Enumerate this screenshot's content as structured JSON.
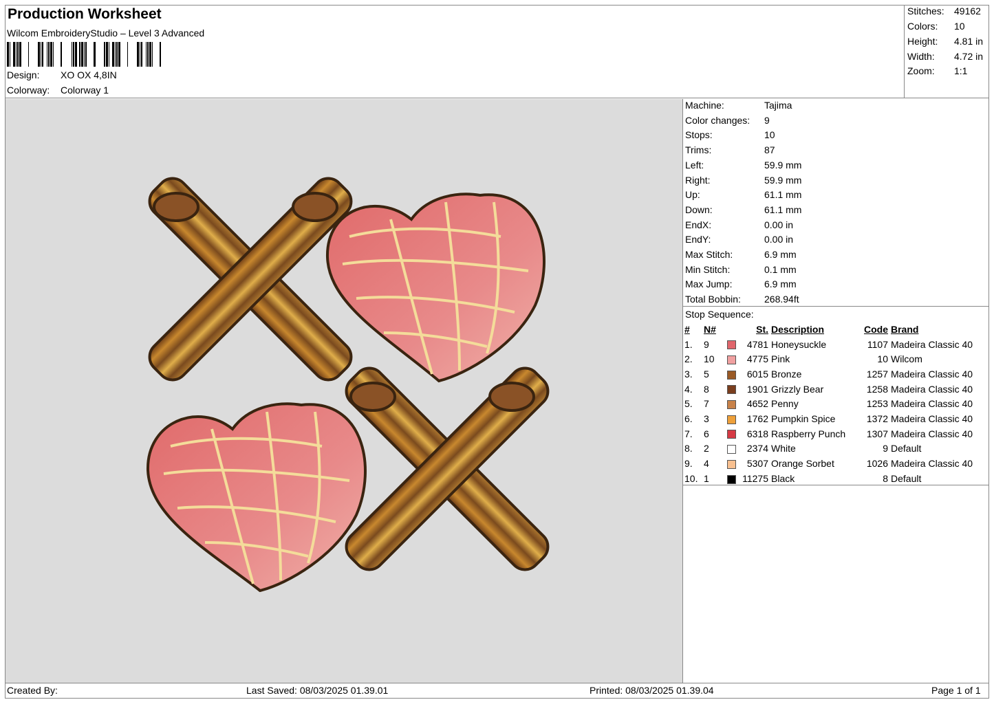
{
  "header": {
    "title": "Production Worksheet",
    "subtitle": "Wilcom EmbroideryStudio – Level 3 Advanced",
    "design_label": "Design:",
    "design_value": "XO OX 4,8IN",
    "colorway_label": "Colorway:",
    "colorway_value": "Colorway 1"
  },
  "stats": [
    {
      "k": "Stitches:",
      "v": "49162"
    },
    {
      "k": "Colors:",
      "v": "10"
    },
    {
      "k": "Height:",
      "v": "4.81 in"
    },
    {
      "k": "Width:",
      "v": "4.72 in"
    },
    {
      "k": "Zoom:",
      "v": "1:1"
    }
  ],
  "info": [
    {
      "k": "Machine:",
      "v": "Tajima"
    },
    {
      "k": "Color changes:",
      "v": "9"
    },
    {
      "k": "Stops:",
      "v": "10"
    },
    {
      "k": "Trims:",
      "v": "87"
    },
    {
      "k": "Left:",
      "v": "59.9 mm"
    },
    {
      "k": "Right:",
      "v": "59.9 mm"
    },
    {
      "k": "Up:",
      "v": "61.1 mm"
    },
    {
      "k": "Down:",
      "v": "61.1 mm"
    },
    {
      "k": "EndX:",
      "v": "0.00 in"
    },
    {
      "k": "EndY:",
      "v": "0.00 in"
    },
    {
      "k": "Max Stitch:",
      "v": "6.9 mm"
    },
    {
      "k": "Min Stitch:",
      "v": "0.1 mm"
    },
    {
      "k": "Max Jump:",
      "v": "6.9 mm"
    },
    {
      "k": "Total Bobbin:",
      "v": "268.94ft"
    }
  ],
  "stops": {
    "label": "Stop Sequence:",
    "headers": [
      "#",
      "N#",
      "St.",
      "Description",
      "Code",
      "Brand"
    ],
    "rows": [
      {
        "n": "1.",
        "nn": "9",
        "color": "#e0666c",
        "st": "4781",
        "desc": "Honeysuckle",
        "code": "1107",
        "brand": "Madeira Classic 40"
      },
      {
        "n": "2.",
        "nn": "10",
        "color": "#f0a0a0",
        "st": "4775",
        "desc": "Pink",
        "code": "10",
        "brand": "Wilcom"
      },
      {
        "n": "3.",
        "nn": "5",
        "color": "#9a5a26",
        "st": "6015",
        "desc": "Bronze",
        "code": "1257",
        "brand": "Madeira Classic 40"
      },
      {
        "n": "4.",
        "nn": "8",
        "color": "#7a3e1e",
        "st": "1901",
        "desc": "Grizzly Bear",
        "code": "1258",
        "brand": "Madeira Classic 40"
      },
      {
        "n": "5.",
        "nn": "7",
        "color": "#c8824a",
        "st": "4652",
        "desc": "Penny",
        "code": "1253",
        "brand": "Madeira Classic 40"
      },
      {
        "n": "6.",
        "nn": "3",
        "color": "#eea03a",
        "st": "1762",
        "desc": "Pumpkin Spice",
        "code": "1372",
        "brand": "Madeira Classic 40"
      },
      {
        "n": "7.",
        "nn": "6",
        "color": "#d63a44",
        "st": "6318",
        "desc": "Raspberry Punch",
        "code": "1307",
        "brand": "Madeira Classic 40"
      },
      {
        "n": "8.",
        "nn": "2",
        "color": "#ffffff",
        "st": "2374",
        "desc": "White",
        "code": "9",
        "brand": "Default"
      },
      {
        "n": "9.",
        "nn": "4",
        "color": "#f8c090",
        "st": "5307",
        "desc": "Orange Sorbet",
        "code": "1026",
        "brand": "Madeira Classic 40"
      },
      {
        "n": "10.",
        "nn": "1",
        "color": "#000000",
        "st": "11275",
        "desc": "Black",
        "code": "8",
        "brand": "Default"
      }
    ]
  },
  "footer": {
    "created_by": "Created By:",
    "last_saved": "Last Saved: 08/03/2025 01.39.01",
    "printed": "Printed: 08/03/2025 01.39.04",
    "page": "Page 1 of 1"
  }
}
